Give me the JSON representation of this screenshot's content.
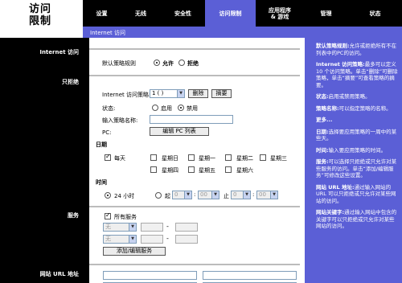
{
  "brand": {
    "line1": "访问",
    "line2": "限制"
  },
  "tabs": [
    {
      "label": "设置"
    },
    {
      "label": "无线"
    },
    {
      "label": "安全性"
    },
    {
      "label": "访问限制"
    },
    {
      "label": "应用程序\n& 游戏"
    },
    {
      "label": "管理"
    },
    {
      "label": "状态"
    }
  ],
  "subnav": {
    "label": "Internet 访问"
  },
  "left_sections": {
    "internet_access": "Internet 访问",
    "blocking": "只拒绝",
    "services": "服务",
    "website_url": "网站 URL 地址"
  },
  "main": {
    "default_policy_label": "默认策略规则",
    "allow_label": "允许",
    "deny_label": "拒绝",
    "policy_label": "Internet 访问策略:",
    "policy_value": "1 ( )",
    "delete_label": "删除",
    "summary_label": "摘要",
    "status_label": "状态:",
    "enable_label": "启用",
    "disable_label": "禁用",
    "policy_name_label": "输入策略名称:",
    "pc_label": "PC:",
    "edit_pc_list_label": "编辑 PC 列表",
    "days_label": "日期",
    "everyday_label": "每天",
    "days": [
      "星期日",
      "星期一",
      "星期二",
      "星期三",
      "星期四",
      "星期五",
      "星期六"
    ],
    "time_label": "时间",
    "hours24_label": "24 小时",
    "from_label": "起",
    "to_label": "止",
    "time_values": {
      "from_h": "0",
      "from_m": "00",
      "to_h": "0",
      "to_m": "00"
    },
    "all_services_label": "所有服务",
    "service_select_value": "无",
    "add_edit_service_label": "添加/编辑服务"
  },
  "help": {
    "p1_title": "默认策略规则:",
    "p1_text": "允许或拒绝所有不在列表中的PC的访问。",
    "p2_title": "Internet 访问策略:",
    "p2_text": "最多可以定义 10 个访问策略。单击“删除”可删除策略，单击“摘要”可查看策略的摘要。",
    "p3_title": "状态:",
    "p3_text": "启用或禁用策略。",
    "p4_title": "策略名称:",
    "p4_text": "可以指定策略的名称。",
    "more": "更多...",
    "p5_title": "日期:",
    "p5_text": "选择要应用策略的一周中的某些天。",
    "p6_title": "时间:",
    "p6_text": "输入要应用策略的时间。",
    "p7_title": "服务:",
    "p7_text": "可以选择只拒绝或只允许对某些服务的访问。单击“添加/编辑服务”可修改这些设置。",
    "p8_title": "网站 URL 地址:",
    "p8_text": "通过输入网站的 URL 可以只拒绝或只允许对某些网站的访问。",
    "p9_title": "网站关键字:",
    "p9_text": "通过输入网站中包含的关键字可以只拒绝或只允许对某些网站的访问。"
  },
  "colors": {
    "accent": "#5b5fd6",
    "nav_bg": "#000000"
  }
}
